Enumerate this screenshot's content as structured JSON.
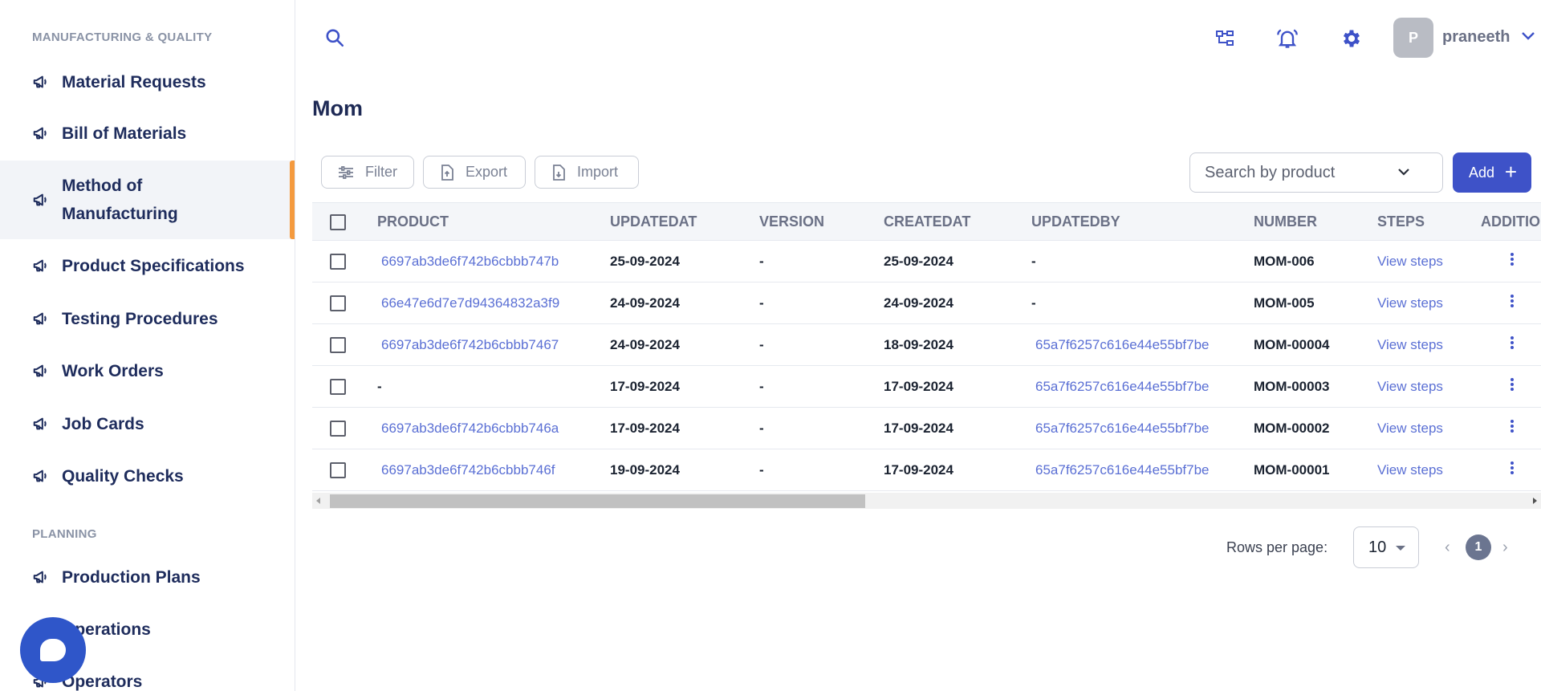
{
  "sidebar": {
    "sections": [
      {
        "title": "MANUFACTURING & QUALITY"
      },
      {
        "title": "PLANNING"
      }
    ],
    "items": [
      {
        "label": "Material Requests"
      },
      {
        "label": "Bill of Materials"
      },
      {
        "label": "Method of Manufacturing"
      },
      {
        "label": "Product Specifications"
      },
      {
        "label": "Testing Procedures"
      },
      {
        "label": "Work Orders"
      },
      {
        "label": "Job Cards"
      },
      {
        "label": "Quality Checks"
      },
      {
        "label": "Production Plans"
      },
      {
        "label": "Operations"
      },
      {
        "label": "Operators"
      }
    ],
    "active_item": "Method of Manufacturing",
    "item_icon": "megaphone-icon"
  },
  "topbar": {
    "icons": [
      "search-icon",
      "sitemap-icon",
      "bell-icon",
      "gear-icon"
    ],
    "avatar_initial": "P",
    "username": "praneeth"
  },
  "page": {
    "title": "Mom"
  },
  "toolbar": {
    "filter_label": "Filter",
    "export_label": "Export",
    "import_label": "Import",
    "search_placeholder": "Search by product",
    "add_label": "Add"
  },
  "table": {
    "columns": [
      "PRODUCT",
      "UPDATEDAT",
      "VERSION",
      "CREATEDAT",
      "UPDATEDBY",
      "NUMBER",
      "STEPS",
      "ADDITIO"
    ],
    "rows": [
      {
        "product": "6697ab3de6f742b6cbbb747b",
        "updatedat": "25-09-2024",
        "version": "-",
        "createdat": "25-09-2024",
        "updatedby": "-",
        "number": "MOM-006",
        "steps": "View steps"
      },
      {
        "product": "66e47e6d7e7d94364832a3f9",
        "updatedat": "24-09-2024",
        "version": "-",
        "createdat": "24-09-2024",
        "updatedby": "-",
        "number": "MOM-005",
        "steps": "View steps"
      },
      {
        "product": "6697ab3de6f742b6cbbb7467",
        "updatedat": "24-09-2024",
        "version": "-",
        "createdat": "18-09-2024",
        "updatedby": "65a7f6257c616e44e55bf7be",
        "number": "MOM-00004",
        "steps": "View steps"
      },
      {
        "product": "-",
        "updatedat": "17-09-2024",
        "version": "-",
        "createdat": "17-09-2024",
        "updatedby": "65a7f6257c616e44e55bf7be",
        "number": "MOM-00003",
        "steps": "View steps"
      },
      {
        "product": "6697ab3de6f742b6cbbb746a",
        "updatedat": "17-09-2024",
        "version": "-",
        "createdat": "17-09-2024",
        "updatedby": "65a7f6257c616e44e55bf7be",
        "number": "MOM-00002",
        "steps": "View steps"
      },
      {
        "product": "6697ab3de6f742b6cbbb746f",
        "updatedat": "19-09-2024",
        "version": "-",
        "createdat": "17-09-2024",
        "updatedby": "65a7f6257c616e44e55bf7be",
        "number": "MOM-00001",
        "steps": "View steps"
      }
    ]
  },
  "pagination": {
    "rows_per_page_label": "Rows per page:",
    "rows_per_page_value": "10",
    "current_page": "1",
    "prev_symbol": "‹",
    "next_symbol": "›"
  },
  "colors": {
    "accent": "#3e52c8",
    "active_indicator": "#f49a3e",
    "link": "#5a6fd4",
    "chat_bubble": "#2f56c9"
  }
}
